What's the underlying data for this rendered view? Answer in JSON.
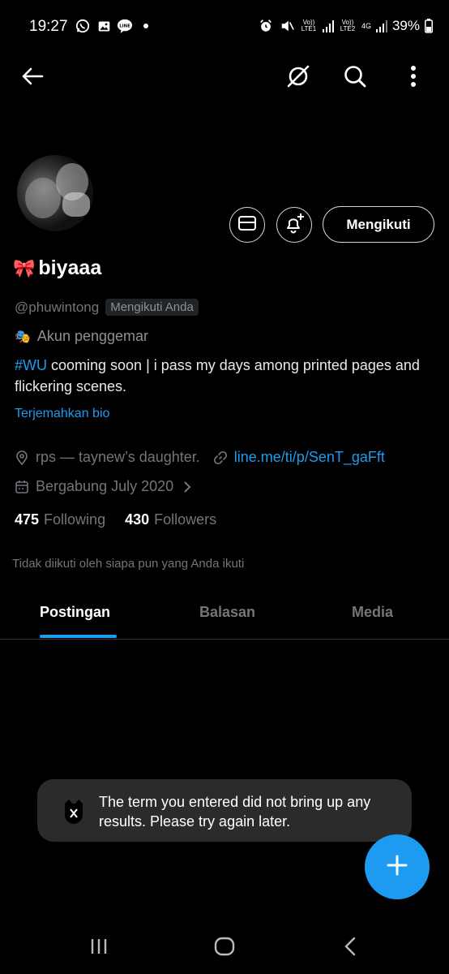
{
  "status_bar": {
    "time": "19:27",
    "left_icons": [
      "whatsapp-icon",
      "gallery-icon",
      "line-icon",
      "dot-icon"
    ],
    "line_badge": "LINE",
    "sim1_label": "Vo)) LTE1",
    "sim2_label": "Vo)) LTE2",
    "network": "4G",
    "battery": "39%"
  },
  "top_bar": {
    "icons": [
      "back-arrow-icon",
      "grok-icon",
      "search-icon",
      "more-vertical-icon"
    ]
  },
  "profile": {
    "display_name": "biyaaa",
    "name_emoji": "🎀",
    "handle": "@phuwintong",
    "follows_you_badge": "Mengikuti Anda",
    "category_emoji": "🎭",
    "category": "Akun penggemar",
    "bio_hashtag": "#WU",
    "bio_text": " cooming soon | i pass my days among printed pages and flickering scenes.",
    "translate_bio": "Terjemahkan bio",
    "location": "rps — taynew’s daughter.",
    "website": "line.me/ti/p/SenT_gaFft",
    "joined": "Bergabung July 2020",
    "following_count": "475",
    "following_label": "Following",
    "followers_count": "430",
    "followers_label": "Followers",
    "not_followed_notice": "Tidak diikuti oleh siapa pun yang Anda ikuti"
  },
  "actions": {
    "message_icon": "mail-icon",
    "notify_icon": "bell-plus-icon",
    "follow_button": "Mengikuti"
  },
  "tabs": [
    {
      "label": "Postingan",
      "active": true
    },
    {
      "label": "Balasan",
      "active": false
    },
    {
      "label": "Media",
      "active": false
    }
  ],
  "toast": {
    "icon": "x-logo-icon",
    "message": "The term you entered did not bring up any results. Please try again later."
  },
  "fab": {
    "icon": "plus-icon"
  },
  "nav_bar": {
    "icons": [
      "recents-icon",
      "home-icon",
      "back-icon"
    ]
  },
  "colors": {
    "background": "#000000",
    "accent": "#1d9bf0",
    "secondary_text": "#71767b",
    "toast_bg": "#2b2b2b"
  }
}
